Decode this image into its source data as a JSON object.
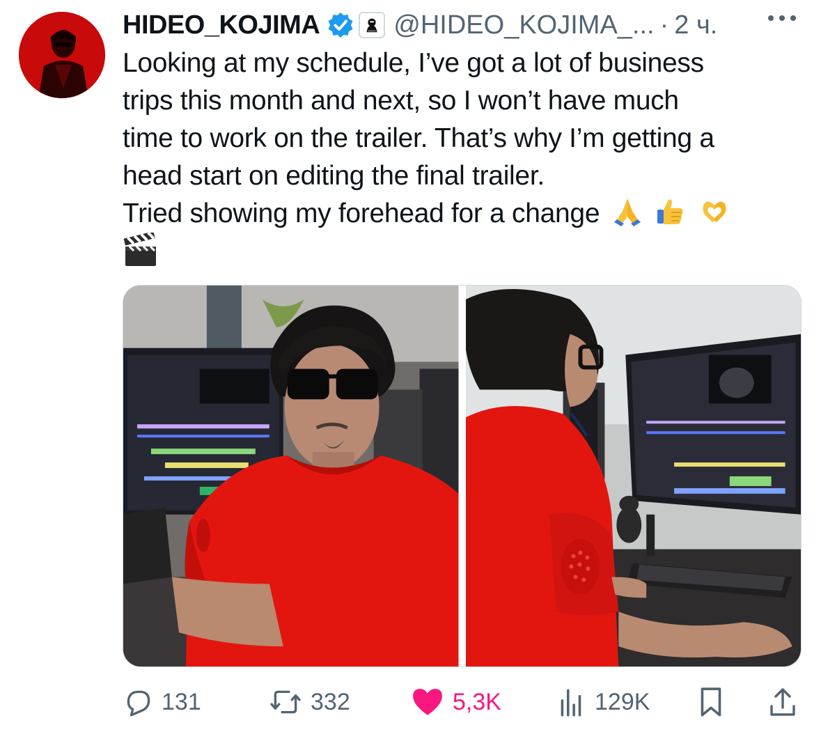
{
  "tweet": {
    "display_name": "HIDEO_KOJIMA",
    "handle": "@HIDEO_KOJIMA_...",
    "separator": "·",
    "time": "2 ч.",
    "text_lines": [
      "Looking at my schedule, I’ve got a lot of business",
      "trips this month and next, so I won’t have much",
      "time to work on the trailer. That’s why I’m getting a",
      "head start on editing the final trailer.",
      "Tried showing my forehead for a change"
    ],
    "emojis": [
      "folded-hands",
      "thumbs-up",
      "heart-hands",
      "clapper-board"
    ]
  },
  "media": {
    "photos": [
      "photo-front-sunglasses",
      "photo-back-editing"
    ]
  },
  "actions": {
    "replies": "131",
    "reposts": "332",
    "likes": "5,3K",
    "views": "129K"
  },
  "colors": {
    "text": "#0f1419",
    "muted": "#536471",
    "verified": "#1d9bf0",
    "like": "#f91880",
    "avatar_bg": "#c40808",
    "shirt": "#e3160f"
  }
}
